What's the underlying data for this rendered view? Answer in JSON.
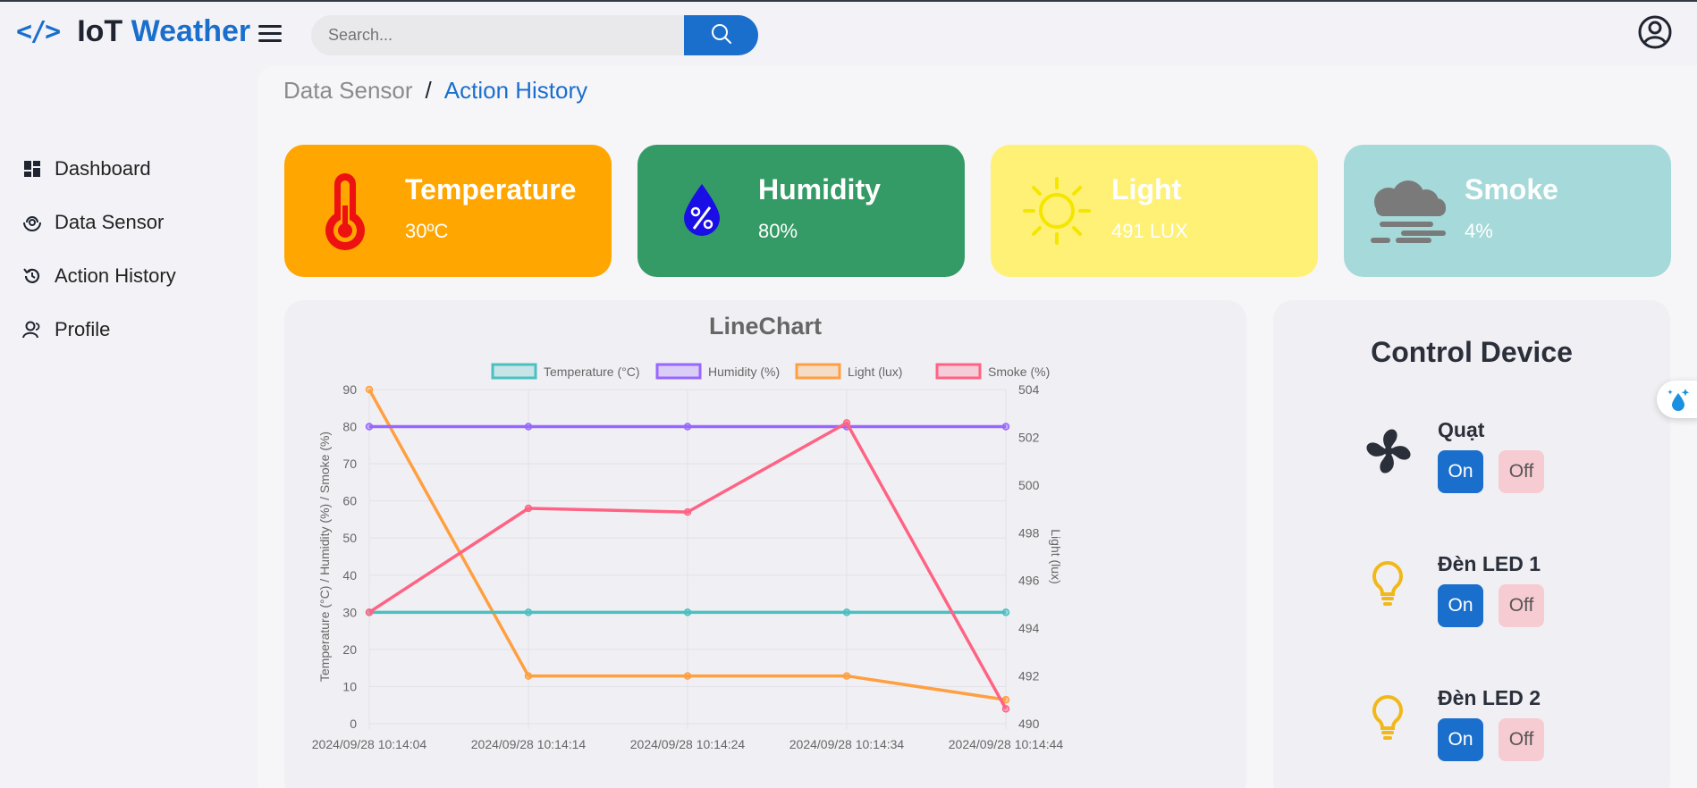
{
  "header": {
    "logo_icon": "</>",
    "logo_part1": "IoT ",
    "logo_part2": "Weather",
    "search_placeholder": "Search...",
    "icons": [
      "code-icon",
      "hamburger-icon",
      "search-icon",
      "user-circle-icon"
    ]
  },
  "sidebar": {
    "items": [
      {
        "label": "Dashboard",
        "icon": "dashboard-icon"
      },
      {
        "label": "Data Sensor",
        "icon": "sensor-icon"
      },
      {
        "label": "Action History",
        "icon": "history-icon"
      },
      {
        "label": "Profile",
        "icon": "user-icon"
      }
    ]
  },
  "breadcrumb": {
    "parent": "Data Sensor",
    "separator": "/",
    "current": "Action History"
  },
  "cards": [
    {
      "title": "Temperature",
      "value": "30ºC",
      "color": "#ffa600",
      "icon": "thermometer-icon"
    },
    {
      "title": "Humidity",
      "value": "80%",
      "color": "#349b66",
      "icon": "humidity-drop-icon"
    },
    {
      "title": "Light",
      "value": "491 LUX",
      "color": "#fff176",
      "icon": "sun-icon"
    },
    {
      "title": "Smoke",
      "value": "4%",
      "color": "#a6d9d9",
      "icon": "smoke-cloud-icon"
    }
  ],
  "chart_data": {
    "type": "line",
    "title": "LineChart",
    "x": [
      "2024/09/28 10:14:04",
      "2024/09/28 10:14:14",
      "2024/09/28 10:14:24",
      "2024/09/28 10:14:34",
      "2024/09/28 10:14:44"
    ],
    "ylabel": "Temperature (°C)   /   Humidity (%)   /   Smoke (%)",
    "y2label": "Light (lux)",
    "ylim": [
      0,
      90
    ],
    "y2lim": [
      490,
      504
    ],
    "yticks": [
      "0",
      "10",
      "20",
      "30",
      "40",
      "50",
      "60",
      "70",
      "80",
      "90"
    ],
    "y2ticks": [
      "490",
      "492",
      "494",
      "496",
      "498",
      "500",
      "502",
      "504"
    ],
    "grid": true,
    "legend_position": "top",
    "series": [
      {
        "name": "Temperature (°C)",
        "axis": "left",
        "color": "#4bc0c0",
        "values": [
          30,
          30,
          30,
          30,
          30
        ]
      },
      {
        "name": "Humidity (%)",
        "axis": "left",
        "color": "#9966ff",
        "values": [
          80,
          80,
          80,
          80,
          80
        ]
      },
      {
        "name": "Light (lux)",
        "axis": "right",
        "color": "#ff9f40",
        "values": [
          504,
          492,
          492,
          492,
          491
        ]
      },
      {
        "name": "Smoke (%)",
        "axis": "left",
        "color": "#ff6384",
        "values": [
          30,
          58,
          57,
          81,
          4
        ]
      }
    ]
  },
  "control": {
    "title": "Control Device",
    "devices": [
      {
        "name": "Quạt",
        "on_label": "On",
        "off_label": "Off",
        "icon": "fan-icon"
      },
      {
        "name": "Đèn LED 1",
        "on_label": "On",
        "off_label": "Off",
        "icon": "bulb-icon"
      },
      {
        "name": "Đèn LED 2",
        "on_label": "On",
        "off_label": "Off",
        "icon": "bulb-icon"
      }
    ]
  },
  "floating_button": {
    "icon": "drops-icon"
  }
}
